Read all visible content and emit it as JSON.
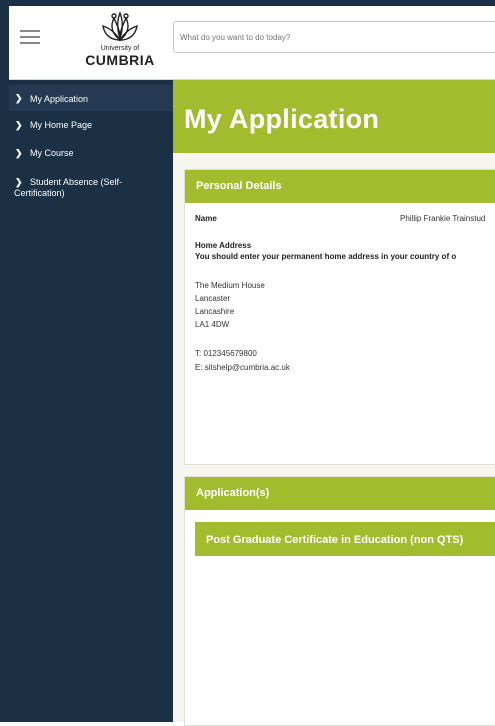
{
  "header": {
    "logo_line1": "University of",
    "logo_line2": "CUMBRIA",
    "search_placeholder": "What do you want to do today?"
  },
  "sidebar": {
    "items": [
      {
        "label": "My Application"
      },
      {
        "label": "My Home Page"
      },
      {
        "label": "My Course"
      },
      {
        "label": "Student Absence (Self-Certification)"
      }
    ]
  },
  "main": {
    "page_title": "My Application",
    "personal_details": {
      "title": "Personal Details",
      "name_label": "Name",
      "name_value": "Phillip Frankie Trainstud",
      "home_address_label": "Home Address",
      "home_address_note": "You should enter your permanent home address in your country of o",
      "address_lines": [
        "The Medium House",
        "Lancaster",
        "Lancashire",
        "LA1 4DW"
      ],
      "phone": "T: 012345679800",
      "email": "E: sitshelp@cumbria.ac.uk"
    },
    "applications": {
      "title": "Application(s)",
      "items": [
        {
          "label": "Post Graduate Certificate in Education (non QTS)"
        }
      ]
    }
  },
  "colors": {
    "sidebar_bg": "#1b2f45",
    "accent_green": "#a2bc2e",
    "main_bg": "#f6f6ef"
  }
}
